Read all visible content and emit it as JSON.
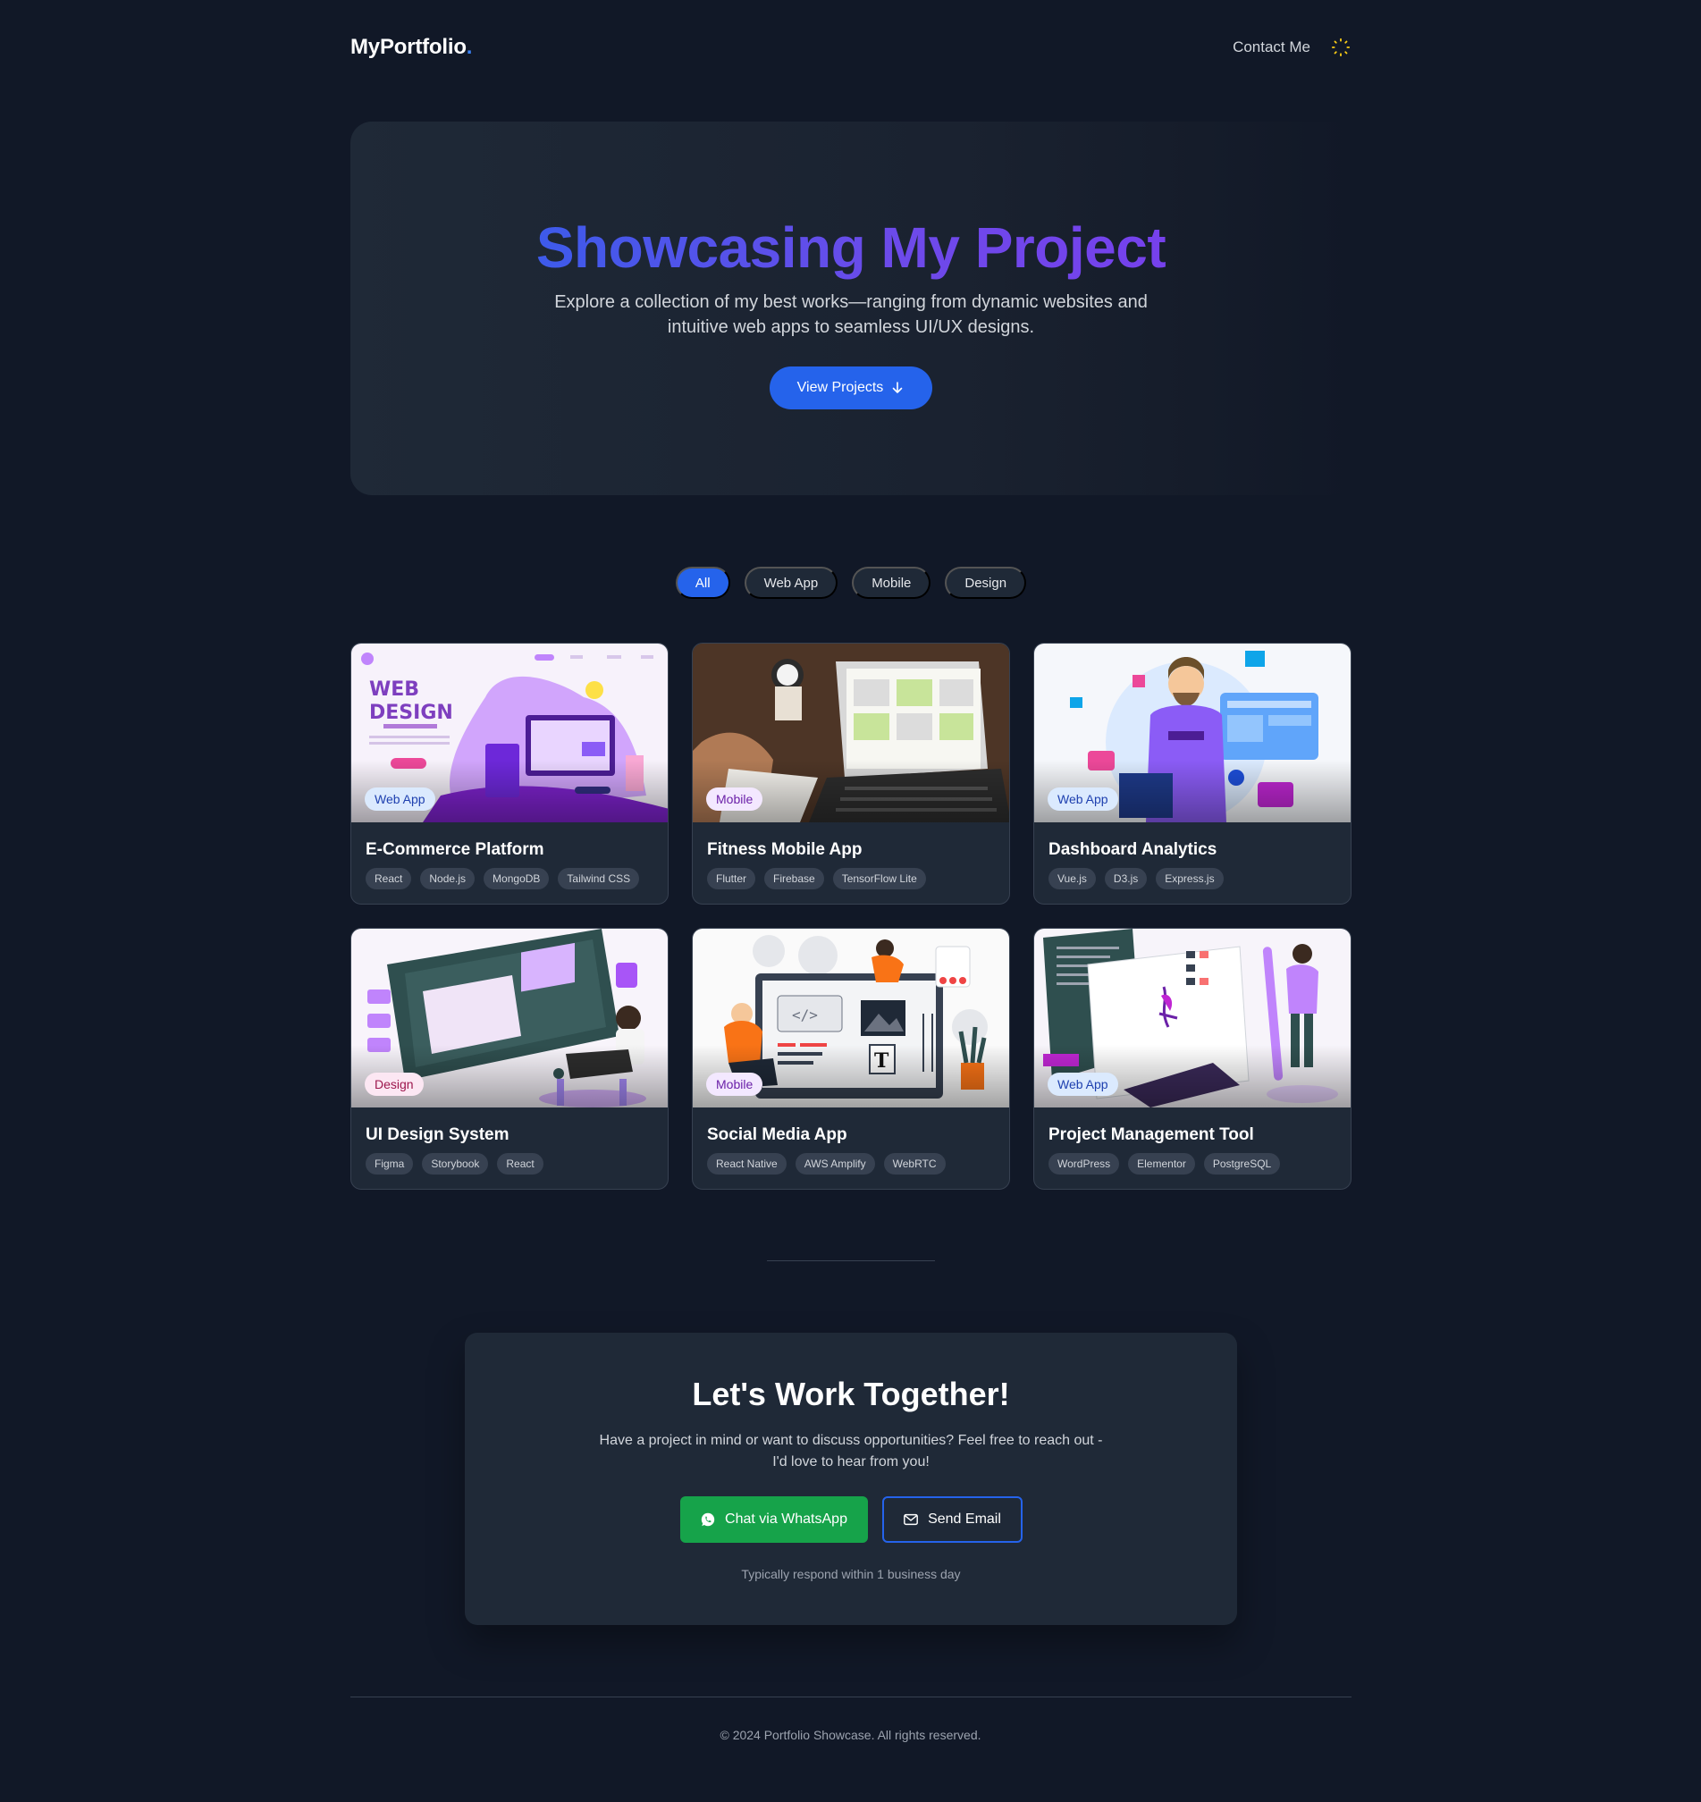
{
  "header": {
    "logo_text": "MyPortfolio",
    "logo_dot": ".",
    "contact_label": "Contact Me",
    "theme_icon": "sun-icon"
  },
  "hero": {
    "title": "Showcasing My Project",
    "subtitle": "Explore a collection of my best works—ranging from dynamic websites and intuitive web apps to seamless UI/UX designs.",
    "button_label": "View Projects",
    "button_icon": "arrow-down-icon"
  },
  "filters": [
    {
      "label": "All",
      "active": true
    },
    {
      "label": "Web App",
      "active": false
    },
    {
      "label": "Mobile",
      "active": false
    },
    {
      "label": "Design",
      "active": false
    }
  ],
  "projects": [
    {
      "title": "E-Commerce Platform",
      "category": "Web App",
      "tags": [
        "React",
        "Node.js",
        "MongoDB",
        "Tailwind CSS"
      ],
      "image": "web-design-illustration"
    },
    {
      "title": "Fitness Mobile App",
      "category": "Mobile",
      "tags": [
        "Flutter",
        "Firebase",
        "TensorFlow Lite"
      ],
      "image": "laptop-wireframe-photo"
    },
    {
      "title": "Dashboard Analytics",
      "category": "Web App",
      "tags": [
        "Vue.js",
        "D3.js",
        "Express.js"
      ],
      "image": "designer-illustration"
    },
    {
      "title": "UI Design System",
      "category": "Design",
      "tags": [
        "Figma",
        "Storybook",
        "React"
      ],
      "image": "website-builder-illustration"
    },
    {
      "title": "Social Media App",
      "category": "Mobile",
      "tags": [
        "React Native",
        "AWS Amplify",
        "WebRTC"
      ],
      "image": "developers-illustration"
    },
    {
      "title": "Project Management Tool",
      "category": "Web App",
      "tags": [
        "WordPress",
        "Elementor",
        "PostgreSQL"
      ],
      "image": "isometric-dev-illustration"
    }
  ],
  "cta": {
    "title": "Let's Work Together!",
    "text": "Have a project in mind or want to discuss opportunities? Feel free to reach out - I'd love to hear from you!",
    "whatsapp_label": "Chat via WhatsApp",
    "email_label": "Send Email",
    "note": "Typically respond within 1 business day"
  },
  "footer": {
    "copyright": "© 2024 Portfolio Showcase. All rights reserved."
  },
  "colors": {
    "background": "#111827",
    "card": "#1f2937",
    "accent": "#2563eb",
    "purple": "#7c3aed",
    "whatsapp": "#16a34a"
  }
}
